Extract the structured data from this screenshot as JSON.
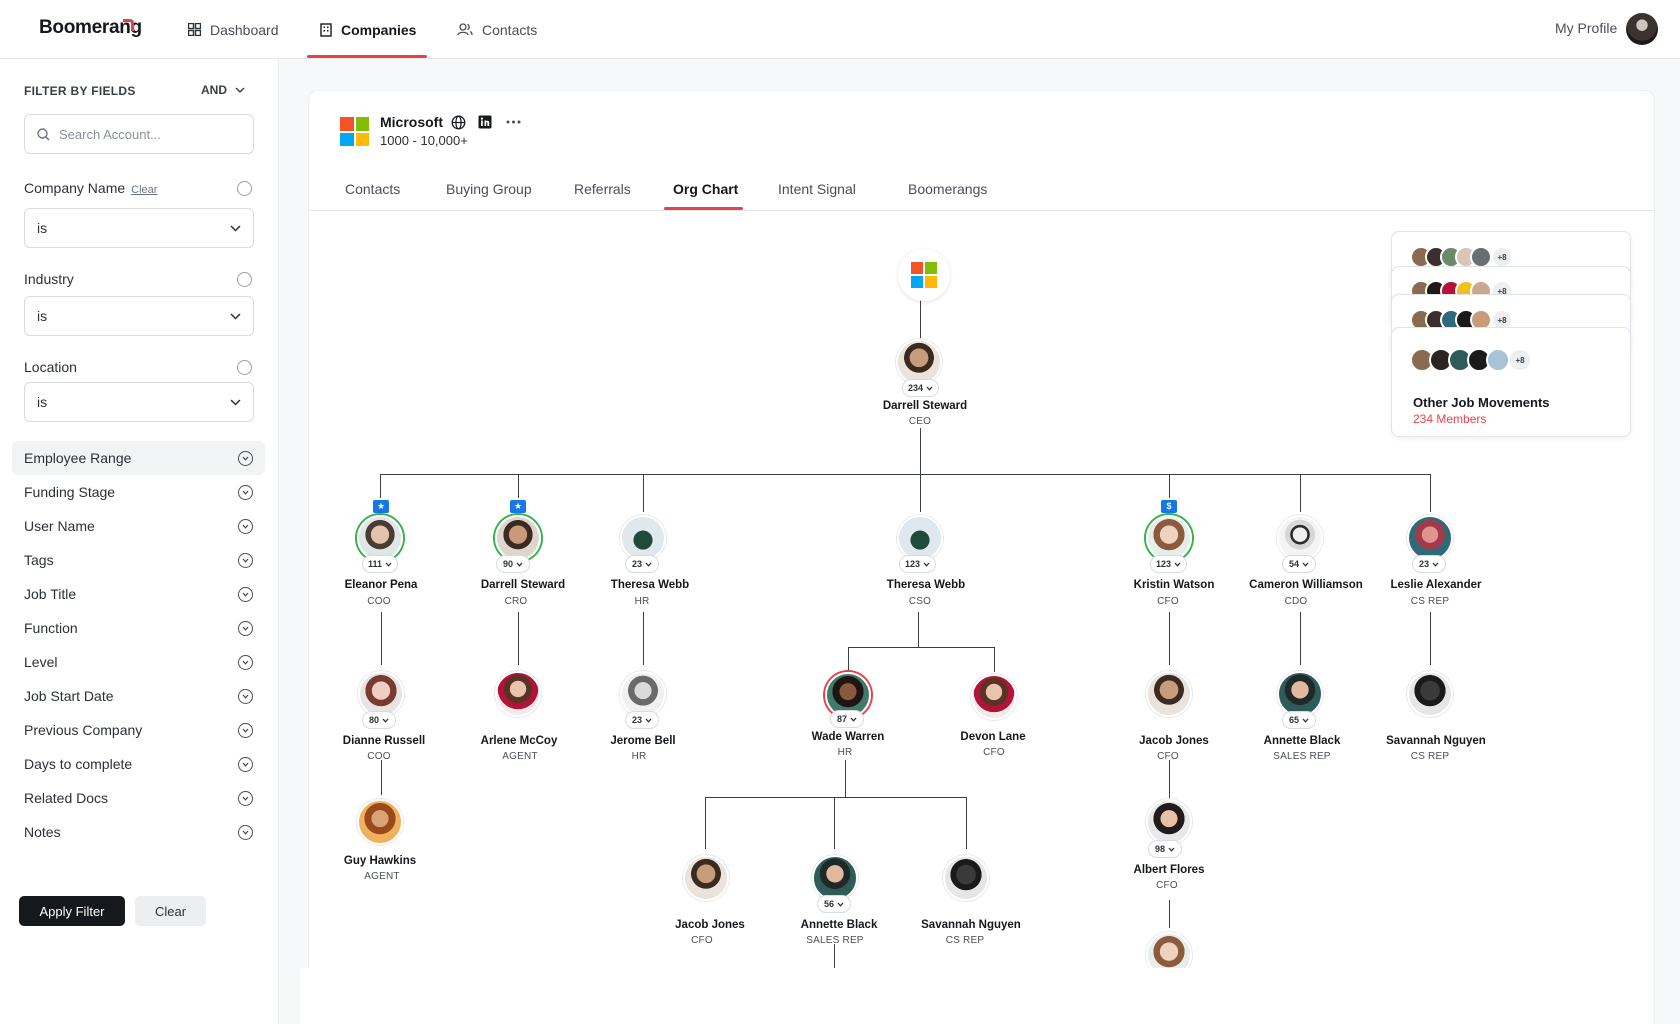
{
  "brand": {
    "name": "Boomerang",
    "accent": "#e8414c"
  },
  "nav": {
    "items": [
      {
        "label": "Dashboard",
        "icon": "grid-icon"
      },
      {
        "label": "Companies",
        "icon": "building-icon",
        "active": true
      },
      {
        "label": "Contacts",
        "icon": "users-icon"
      }
    ],
    "profile_label": "My Profile"
  },
  "sidebar": {
    "title": "FILTER BY FIELDS",
    "logic": "AND",
    "search_placeholder": "Search Account...",
    "clear_link": "Clear",
    "fields": [
      {
        "label": "Company Name",
        "operator": "is",
        "expanded": true
      },
      {
        "label": "Industry",
        "operator": "is",
        "expanded": true
      },
      {
        "label": "Location",
        "operator": "is",
        "expanded": true
      }
    ],
    "filters": [
      "Employee Range",
      "Funding Stage",
      "User Name",
      "Tags",
      "Job Title",
      "Function",
      "Level",
      "Job Start Date",
      "Previous Company",
      "Days to complete",
      "Related Docs",
      "Notes"
    ],
    "apply_label": "Apply Filter",
    "clear_label": "Clear"
  },
  "company": {
    "name": "Microsoft",
    "size": "1000 - 10,000+",
    "tabs": [
      "Contacts",
      "Buying Group",
      "Referrals",
      "Org Chart",
      "Intent Signal",
      "Boomerangs"
    ],
    "active_tab": "Org Chart"
  },
  "org": {
    "ceo": {
      "name": "Darrell Steward",
      "role": "CEO",
      "count": "234"
    },
    "level1": [
      {
        "name": "Eleanor Pena",
        "role": "COO",
        "count": "111",
        "badge": "★"
      },
      {
        "name": "Darrell Steward",
        "role": "CRO",
        "count": "90",
        "badge": "★"
      },
      {
        "name": "Theresa Webb",
        "role": "HR",
        "count": "23"
      },
      {
        "name": "Theresa Webb",
        "role": "CSO",
        "count": "123"
      },
      {
        "name": "Kristin Watson",
        "role": "CFO",
        "count": "123",
        "badge": "$"
      },
      {
        "name": "Cameron Williamson",
        "role": "CDO",
        "count": "54"
      },
      {
        "name": "Leslie Alexander",
        "role": "CS REP",
        "count": "23"
      }
    ],
    "level2": [
      {
        "name": "Dianne Russell",
        "role": "COO",
        "count": "80"
      },
      {
        "name": "Arlene McCoy",
        "role": "AGENT"
      },
      {
        "name": "Jerome Bell",
        "role": "HR",
        "count": "23"
      },
      {
        "name": "Wade Warren",
        "role": "HR",
        "count": "87"
      },
      {
        "name": "Devon Lane",
        "role": "CFO"
      },
      {
        "name": "Jacob Jones",
        "role": "CFO"
      },
      {
        "name": "Annette Black",
        "role": "SALES REP",
        "count": "65"
      },
      {
        "name": "Savannah Nguyen",
        "role": "CS REP"
      }
    ],
    "level3": [
      {
        "name": "Guy Hawkins",
        "role": "AGENT"
      },
      {
        "name": "Jacob Jones",
        "role": "CFO"
      },
      {
        "name": "Annette Black",
        "role": "SALES REP",
        "count": "56"
      },
      {
        "name": "Savannah Nguyen",
        "role": "CS REP"
      },
      {
        "name": "Albert Flores",
        "role": "CFO",
        "count": "98"
      }
    ]
  },
  "job_movements": {
    "title": "Other Job Movements",
    "members": "234 Members",
    "more": "+8"
  }
}
